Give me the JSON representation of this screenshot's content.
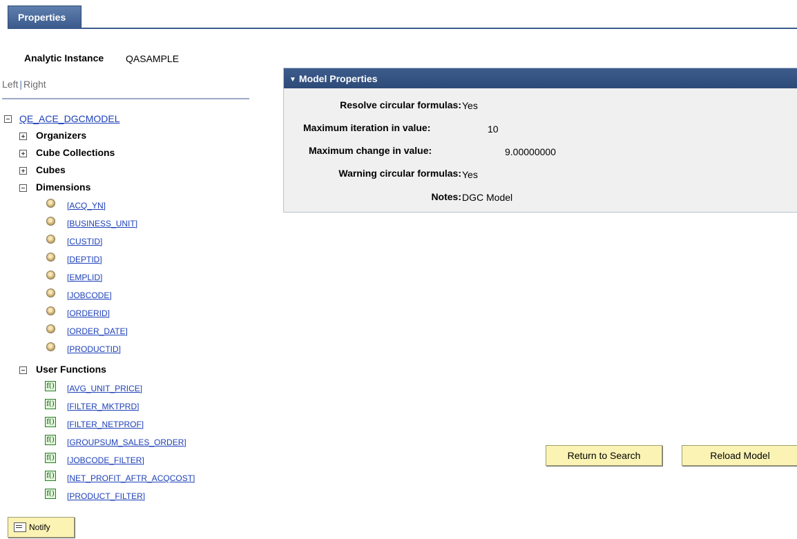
{
  "tab": {
    "label": "Properties"
  },
  "analytic_instance": {
    "label": "Analytic Instance",
    "value": "QASAMPLE"
  },
  "left_right": {
    "left": "Left",
    "separator": "|",
    "right": "Right"
  },
  "tree": {
    "root": "QE_ACE_DGCMODEL",
    "groups": [
      "Organizers",
      "Cube Collections",
      "Cubes",
      "Dimensions",
      "User Functions"
    ],
    "dimensions": [
      "[ACQ_YN]",
      "[BUSINESS_UNIT]",
      "[CUSTID]",
      "[DEPTID]",
      "[EMPLID]",
      "[JOBCODE]",
      "[ORDERID]",
      "[ORDER_DATE]",
      "[PRODUCTID]"
    ],
    "functions": [
      "[AVG_UNIT_PRICE]",
      "[FILTER_MKTPRD]",
      "[FILTER_NETPROF]",
      "[GROUPSUM_SALES_ORDER]",
      "[JOBCODE_FILTER]",
      "[NET_PROFIT_AFTR_ACQCOST]",
      "[PRODUCT_FILTER]"
    ],
    "function_icon_text": "f()"
  },
  "model_properties": {
    "title": "Model Properties",
    "rows": [
      {
        "label": "Resolve circular formulas:",
        "value": "Yes"
      },
      {
        "label": "Maximum iteration in value:",
        "value": "10"
      },
      {
        "label": "Maximum change in value:",
        "value": "9.00000000"
      },
      {
        "label": "Warning circular formulas:",
        "value": "Yes"
      },
      {
        "label": "Notes:",
        "value": "DGC Model"
      }
    ]
  },
  "buttons": {
    "return": "Return to Search",
    "reload": "Reload Model",
    "notify": "Notify"
  },
  "colors": {
    "header": "#3b5a8c",
    "button": "#fbf3b4",
    "link": "#1c3fb8"
  }
}
